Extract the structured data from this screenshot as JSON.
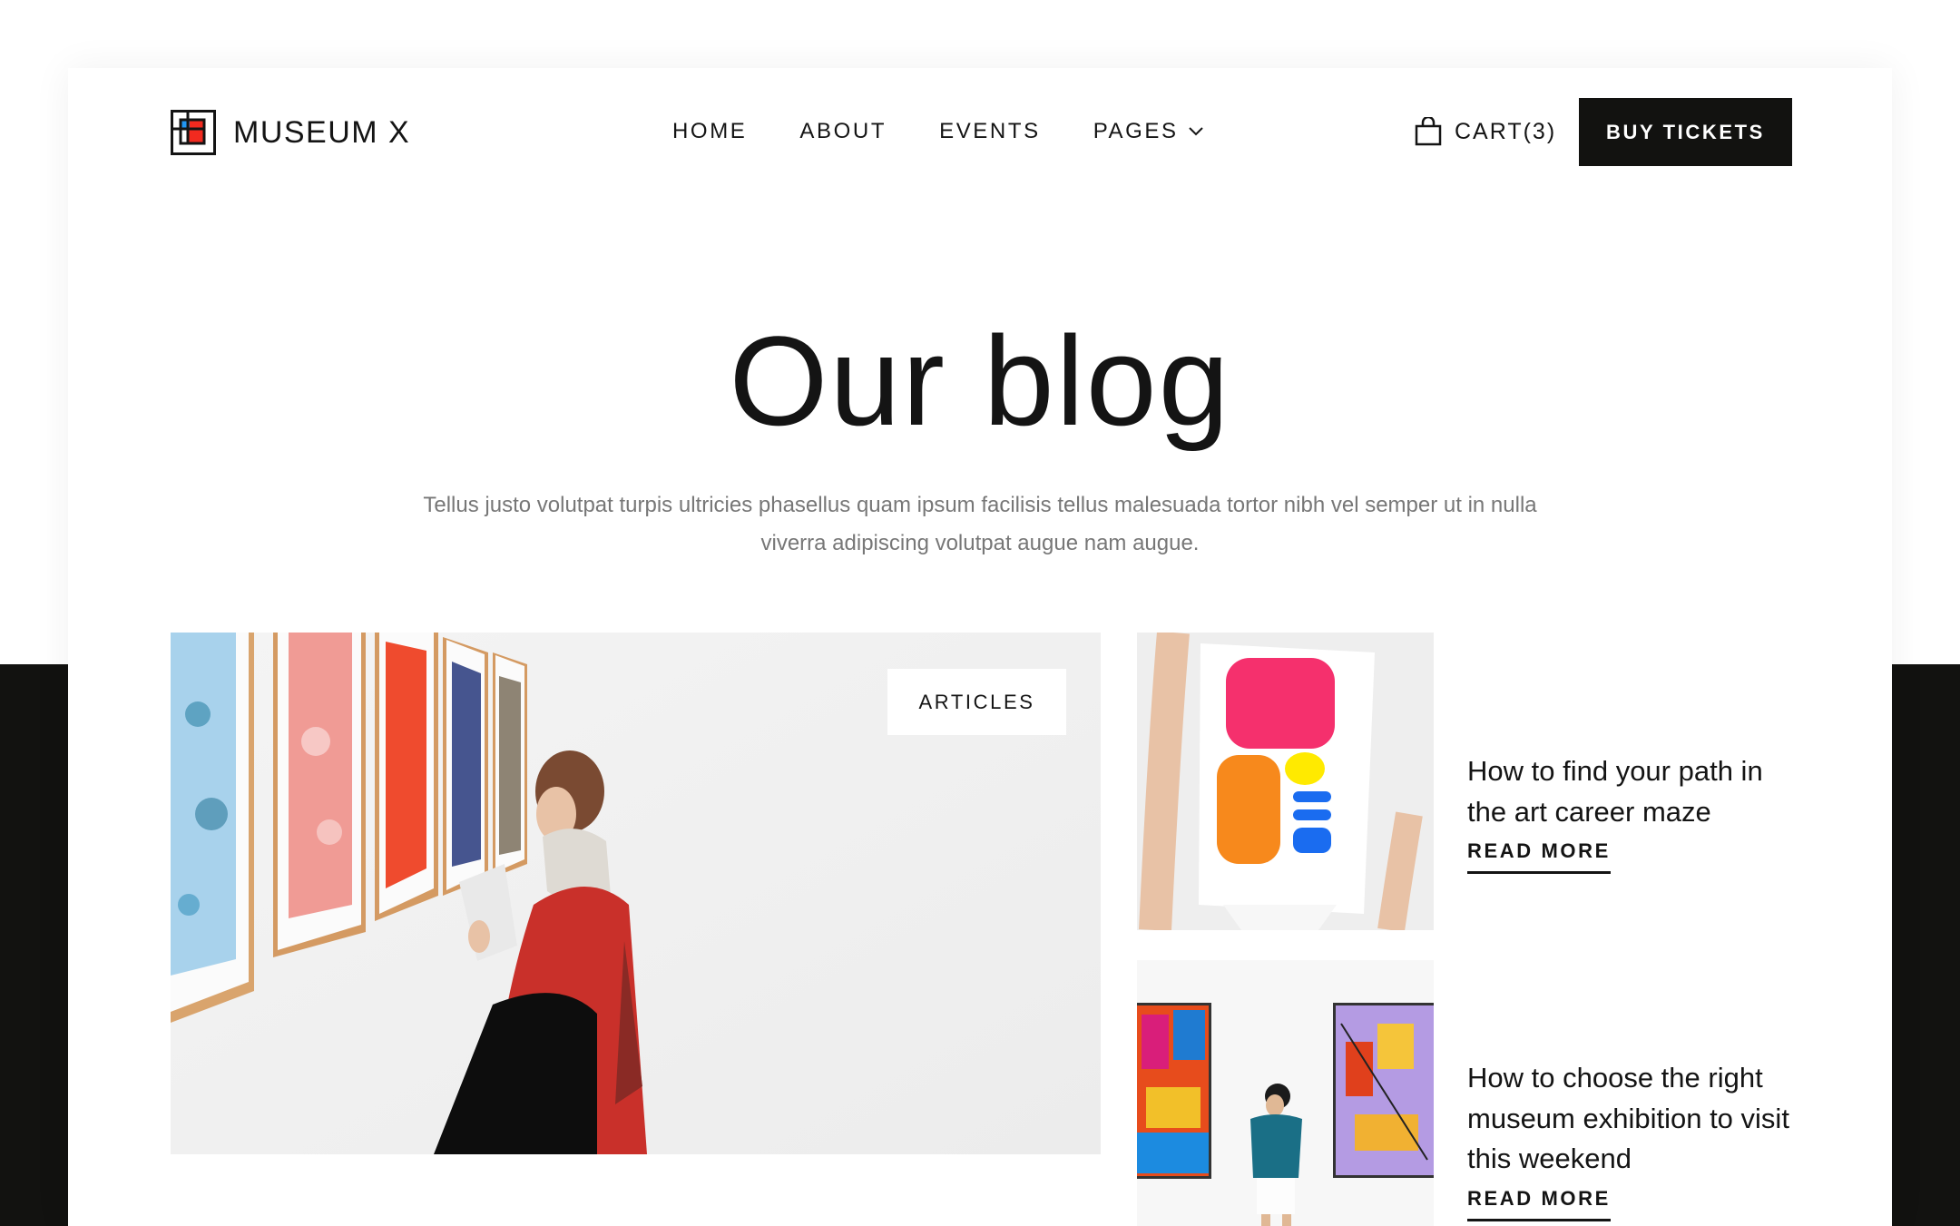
{
  "header": {
    "logo_text": "MUSEUM X",
    "logo_icon": "mondrian-square-logo",
    "nav": [
      {
        "label": "HOME"
      },
      {
        "label": "ABOUT"
      },
      {
        "label": "EVENTS"
      },
      {
        "label": "PAGES",
        "has_dropdown": true,
        "icon": "chevron-down-icon"
      }
    ],
    "cart": {
      "label": "CART(3)",
      "icon": "shopping-bag-icon",
      "count": 3
    },
    "cta_label": "BUY TICKETS"
  },
  "hero": {
    "title": "Our blog",
    "subtitle": "Tellus justo volutpat turpis ultricies phasellus quam ipsum facilisis tellus malesuada tortor nibh vel semper ut in nulla viverra adipiscing volutpat augue nam augue."
  },
  "featured": {
    "category": "ARTICLES",
    "image": "woman reading a leaflet in front of framed botanical posters"
  },
  "posts": [
    {
      "title": "How to find your path in the art career maze",
      "link_label": "READ MORE",
      "image": "person holding colorful abstract painting"
    },
    {
      "title": "How to choose the right museum exhibition to visit this weekend",
      "link_label": "READ MORE",
      "image": "man standing between two abstract paintings"
    }
  ],
  "colors": {
    "ink": "#141414",
    "band": "#121210",
    "muted_text": "#777777",
    "logo_blue": "#2196f3",
    "logo_red": "#f22a1f"
  }
}
